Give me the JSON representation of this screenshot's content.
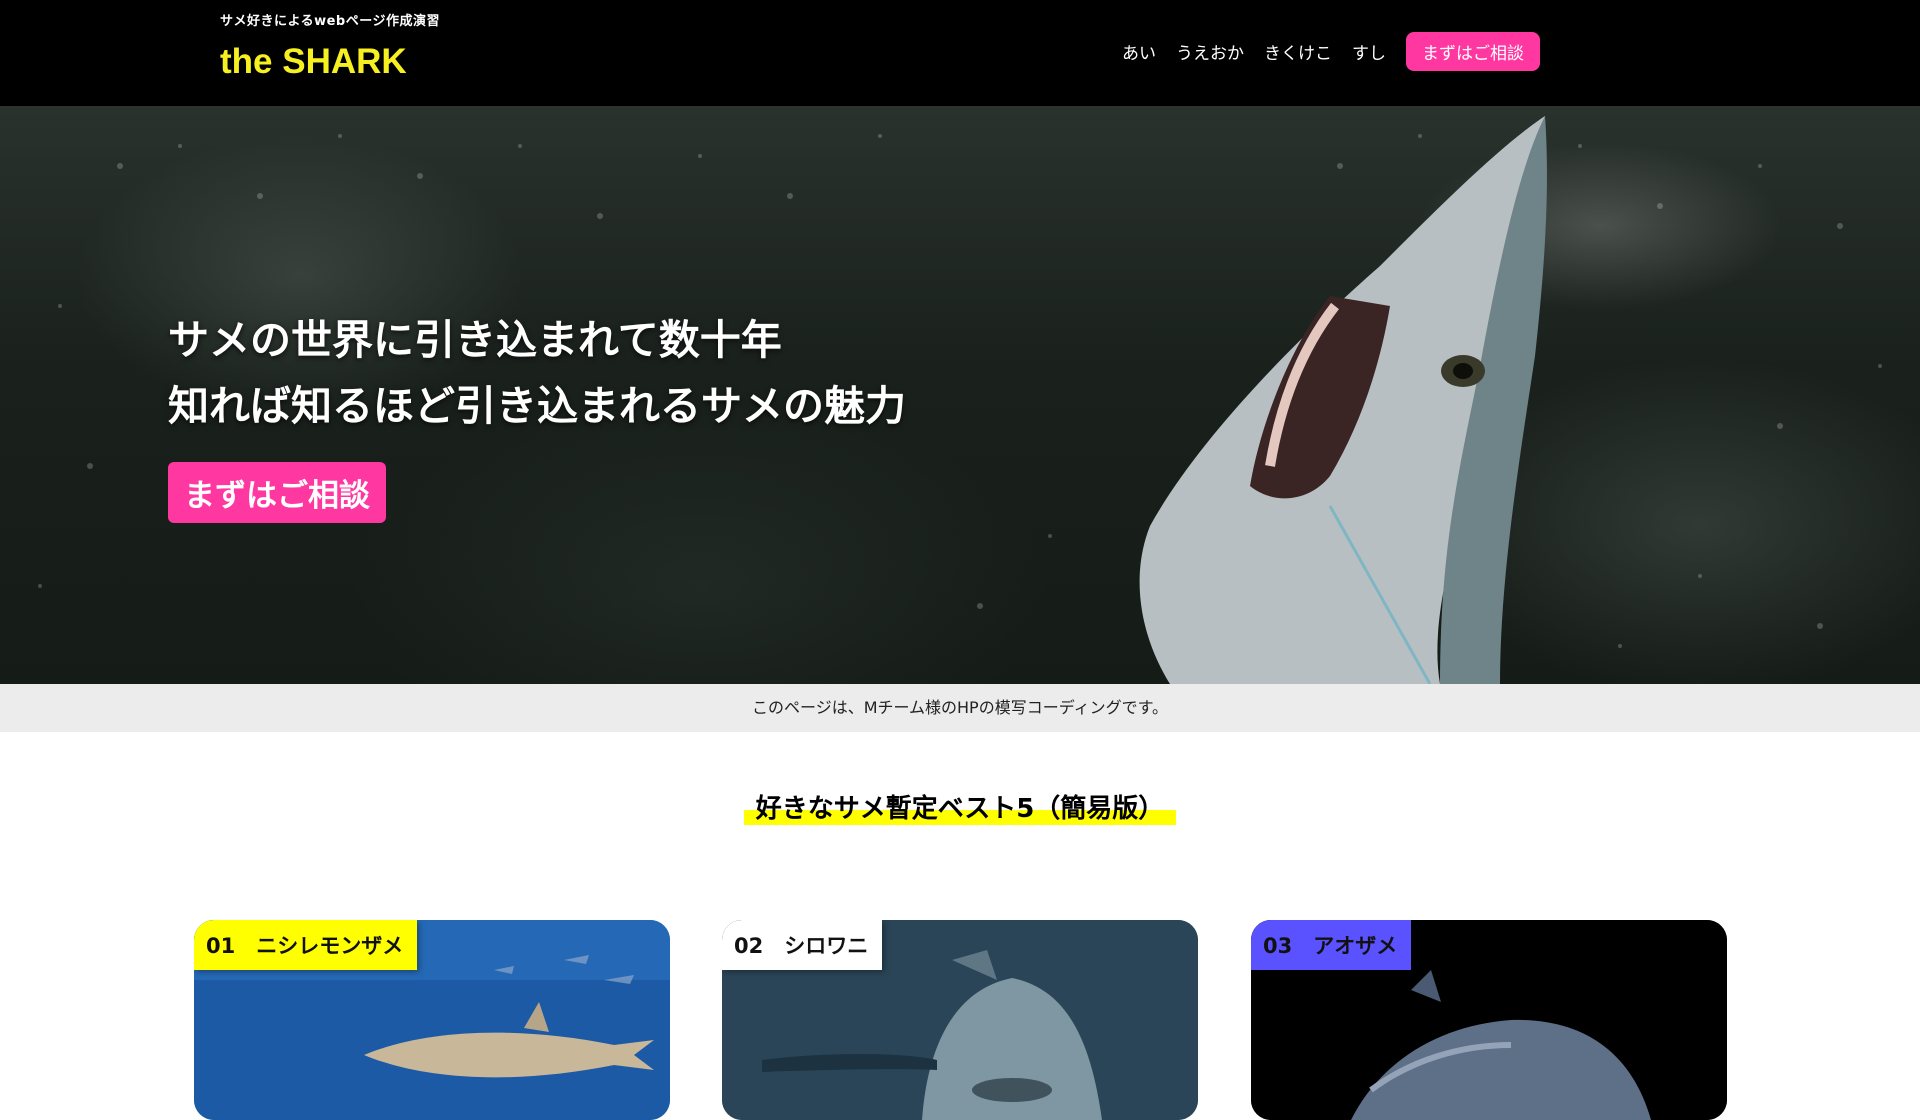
{
  "header": {
    "tagline": "サメ好きによるwebページ作成演習",
    "logo": "the SHARK",
    "nav": [
      "あい",
      "うえおか",
      "きくけこ",
      "すし"
    ],
    "cta": "まずはご相談"
  },
  "hero": {
    "line1": "サメの世界に引き込まれて数十年",
    "line2": "知れば知るほど引き込まれるサメの魅力",
    "cta": "まずはご相談"
  },
  "notice": "このページは、Mチーム様のHPの模写コーディングです。",
  "section": {
    "title": "好きなサメ暫定ベスト5（簡易版）"
  },
  "cards": [
    {
      "label": "01　ニシレモンザメ",
      "tag_color": "#ffff00"
    },
    {
      "label": "02　シロワニ",
      "tag_color": "#ffffff"
    },
    {
      "label": "03　アオザメ",
      "tag_color": "#5b52ff"
    }
  ],
  "colors": {
    "accent_pink": "#ff37a0",
    "logo_yellow": "#f7f020",
    "highlight_yellow": "#ffff00",
    "header_bg": "#000000"
  }
}
